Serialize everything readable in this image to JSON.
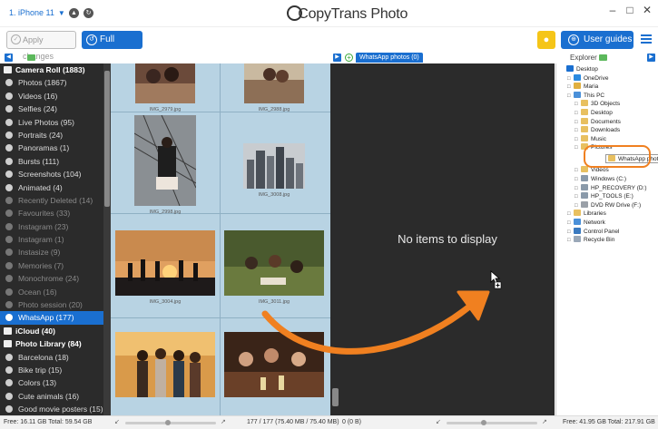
{
  "app": {
    "title": "CopyTrans Photo",
    "device": "1. iPhone 11"
  },
  "toolbar": {
    "apply_label": "Apply changes",
    "backup_label": "Full Backup",
    "guides_label": "User guides"
  },
  "panel": {
    "album_tab": "WhatsApp photos (0)",
    "explorer_label": "Explorer",
    "empty_text": "No items to display"
  },
  "sidebar": {
    "items": [
      {
        "label": "Camera Roll (1883)",
        "kind": "header"
      },
      {
        "label": "Photos (1867)",
        "kind": "item"
      },
      {
        "label": "Videos (16)",
        "kind": "item"
      },
      {
        "label": "Selfies (24)",
        "kind": "item"
      },
      {
        "label": "Live Photos (95)",
        "kind": "item"
      },
      {
        "label": "Portraits (24)",
        "kind": "item"
      },
      {
        "label": "Panoramas (1)",
        "kind": "item"
      },
      {
        "label": "Bursts (111)",
        "kind": "item"
      },
      {
        "label": "Screenshots (104)",
        "kind": "item"
      },
      {
        "label": "Animated (4)",
        "kind": "item"
      },
      {
        "label": "Recently Deleted (14)",
        "kind": "dim"
      },
      {
        "label": "Favourites (33)",
        "kind": "dim"
      },
      {
        "label": "Instagram (23)",
        "kind": "dim"
      },
      {
        "label": "Instagram (1)",
        "kind": "dim"
      },
      {
        "label": "Instasize (9)",
        "kind": "dim"
      },
      {
        "label": "Memories (7)",
        "kind": "dim"
      },
      {
        "label": "Monochrome (24)",
        "kind": "dim"
      },
      {
        "label": "Ocean (16)",
        "kind": "dim"
      },
      {
        "label": "Photo session (20)",
        "kind": "dim"
      },
      {
        "label": "WhatsApp (177)",
        "kind": "selected"
      },
      {
        "label": "iCloud (40)",
        "kind": "header"
      },
      {
        "label": "Photo Library (84)",
        "kind": "header"
      },
      {
        "label": "Barcelona (18)",
        "kind": "item"
      },
      {
        "label": "Bike trip (15)",
        "kind": "item"
      },
      {
        "label": "Colors (13)",
        "kind": "item"
      },
      {
        "label": "Cute animals (16)",
        "kind": "item"
      },
      {
        "label": "Good movie posters (15)",
        "kind": "item"
      }
    ]
  },
  "grid": {
    "captions": [
      "IMG_2979.jpg",
      "IMG_2988.jpg",
      "IMG_2998.jpg",
      "IMG_3008.jpg",
      "IMG_3004.jpg",
      "IMG_3011.jpg"
    ]
  },
  "explorer": {
    "items": [
      {
        "label": "Desktop",
        "indent": 0,
        "icon": "desktop"
      },
      {
        "label": "OneDrive",
        "indent": 1,
        "icon": "cloud"
      },
      {
        "label": "Maria",
        "indent": 1,
        "icon": "user"
      },
      {
        "label": "This PC",
        "indent": 1,
        "icon": "pc"
      },
      {
        "label": "3D Objects",
        "indent": 2,
        "icon": "folder"
      },
      {
        "label": "Desktop",
        "indent": 2,
        "icon": "folder"
      },
      {
        "label": "Documents",
        "indent": 2,
        "icon": "folder"
      },
      {
        "label": "Downloads",
        "indent": 2,
        "icon": "folder"
      },
      {
        "label": "Music",
        "indent": 2,
        "icon": "folder"
      },
      {
        "label": "Pictures",
        "indent": 2,
        "icon": "folder"
      },
      {
        "label": "WhatsApp photos",
        "indent": 3,
        "icon": "folder",
        "highlight": true
      },
      {
        "label": "Videos",
        "indent": 2,
        "icon": "folder"
      },
      {
        "label": "Windows (C:)",
        "indent": 2,
        "icon": "drive"
      },
      {
        "label": "HP_RECOVERY (D:)",
        "indent": 2,
        "icon": "drive"
      },
      {
        "label": "HP_TOOLS (E:)",
        "indent": 2,
        "icon": "drive"
      },
      {
        "label": "DVD RW Drive (F:)",
        "indent": 2,
        "icon": "dvd"
      },
      {
        "label": "Libraries",
        "indent": 1,
        "icon": "library"
      },
      {
        "label": "Network",
        "indent": 1,
        "icon": "network"
      },
      {
        "label": "Control Panel",
        "indent": 1,
        "icon": "control"
      },
      {
        "label": "Recycle Bin",
        "indent": 1,
        "icon": "bin"
      }
    ]
  },
  "status": {
    "left_free": "Free: 16.11 GB Total: 59.54 GB",
    "count": "177 / 177 (75.40 MB / 75.40 MB)",
    "mid_size": "0 (0 B)",
    "right_free": "Free: 41.95 GB Total: 217.91 GB"
  },
  "colors": {
    "accent": "#1a6fd0",
    "highlight_ring": "#f08020",
    "panel_dark": "#2b2b2b",
    "grid_bg": "#b8d3e3"
  }
}
